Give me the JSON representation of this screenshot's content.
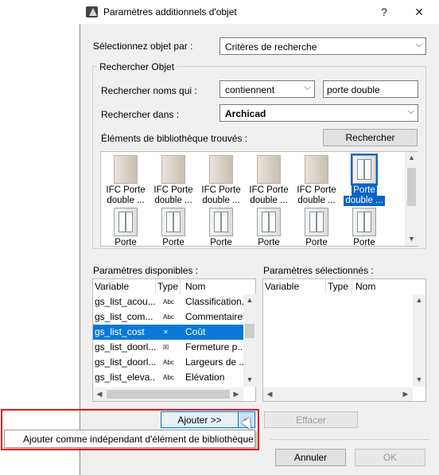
{
  "dialog": {
    "title": "Paramètres additionnels d'objet",
    "help_label": "?",
    "close_label": "✕"
  },
  "select_by": {
    "label": "Sélectionnez objet par :",
    "value": "Critères de recherche"
  },
  "search_group": {
    "title": "Rechercher Objet",
    "names_label": "Rechercher noms qui :",
    "condition_value": "contiennent",
    "search_text": "porte double",
    "search_in_label": "Rechercher dans :",
    "search_in_value": "Archicad",
    "found_label": "Éléments de bibliothèque trouvés :",
    "search_button": "Rechercher"
  },
  "library_items": [
    {
      "line1": "IFC Porte",
      "line2": "double ..."
    },
    {
      "line1": "IFC Porte",
      "line2": "double ..."
    },
    {
      "line1": "IFC Porte",
      "line2": "double ..."
    },
    {
      "line1": "IFC Porte",
      "line2": "double ..."
    },
    {
      "line1": "IFC Porte",
      "line2": "double ..."
    },
    {
      "line1": "Porte",
      "line2": "double ..."
    },
    {
      "line1": "Porte",
      "line2": ""
    },
    {
      "line1": "Porte",
      "line2": ""
    },
    {
      "line1": "Porte",
      "line2": ""
    },
    {
      "line1": "Porte",
      "line2": ""
    },
    {
      "line1": "Porte",
      "line2": ""
    },
    {
      "line1": "Porte",
      "line2": ""
    }
  ],
  "available": {
    "label": "Paramètres disponibles :",
    "columns": [
      "Variable",
      "Type",
      "Nom"
    ],
    "rows": [
      {
        "variable": "gs_list_acou...",
        "type": "Abc",
        "name": "Classification..."
      },
      {
        "variable": "gs_list_com...",
        "type": "Abc",
        "name": "Commentaires"
      },
      {
        "variable": "gs_list_cost",
        "type": "✕",
        "name": "Coût"
      },
      {
        "variable": "gs_list_doorl...",
        "type": "☒",
        "name": "Fermeture p..."
      },
      {
        "variable": "gs_list_doorl...",
        "type": "Abc",
        "name": "Largeurs de ..."
      },
      {
        "variable": "gs_list_eleva...",
        "type": "Abc",
        "name": "Elévation"
      }
    ]
  },
  "selected": {
    "label": "Paramètres sélectionnés :",
    "columns": [
      "Variable",
      "Type",
      "Nom"
    ]
  },
  "actions": {
    "add_button": "Ajouter >>",
    "clear_button": "Effacer",
    "popup_item": "Ajouter comme indépendant d'élément de bibliothèque",
    "cancel_button": "Annuler",
    "ok_button": "OK"
  },
  "colors": {
    "selection": "#0a78d7",
    "highlight": "#e0191e"
  }
}
